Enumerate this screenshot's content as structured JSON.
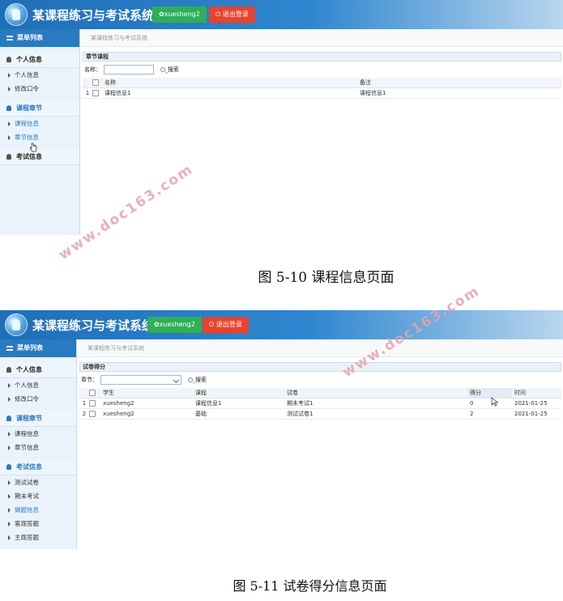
{
  "screenshot1": {
    "app_title": "某课程练习与考试系统",
    "user_button": "✿xuesheng2",
    "logout_button": "⏻ 退出登录",
    "sidebar": {
      "header": "菜单列表",
      "groups": [
        {
          "label": "个人信息",
          "items": [
            "个人信息",
            "修改口令"
          ]
        },
        {
          "label": "课程章节",
          "items": [
            "课程信息",
            "章节信息"
          ]
        },
        {
          "label": "考试信息",
          "items": []
        }
      ]
    },
    "breadcrumb": "某课程练习与考试系统",
    "panel_title": "章节课程",
    "filter_label": "名称：",
    "search_label": "搜索",
    "table": {
      "headers": [
        "名称",
        "备注"
      ],
      "rows": [
        {
          "no": "1",
          "name": "课程信息1",
          "note": "课程信息1"
        }
      ]
    }
  },
  "caption1": "图 5-10 课程信息页面",
  "screenshot2": {
    "app_title": "某课程练习与考试系统",
    "user_button": "✿xuesheng2",
    "logout_button": "⏻ 退出登录",
    "sidebar": {
      "header": "菜单列表",
      "groups": [
        {
          "label": "个人信息",
          "items": [
            "个人信息",
            "修改口令"
          ]
        },
        {
          "label": "课程章节",
          "items": [
            "课程信息",
            "章节信息"
          ]
        },
        {
          "label": "考试信息",
          "items": [
            "测试试卷",
            "期末考试",
            "做题信息",
            "客观答题",
            "主观答题"
          ]
        }
      ]
    },
    "breadcrumb": "某课程练习与考试系统",
    "panel_title": "试卷得分",
    "filter_label": "章节：",
    "search_label": "搜索",
    "table": {
      "headers": [
        "学生",
        "课程",
        "试卷",
        "得分",
        "时间"
      ],
      "rows": [
        {
          "no": "1",
          "student": "xuesheng2",
          "course": "课程信息1",
          "paper": "期末考试1",
          "score": "0",
          "time": "2021-01-25"
        },
        {
          "no": "2",
          "student": "xuesheng2",
          "course": "基础",
          "paper": "测试试卷1",
          "score": "2",
          "time": "2021-01-25"
        }
      ]
    }
  },
  "caption2": "图 5-11 试卷得分信息页面",
  "watermark": "www.doc163.com",
  "colors": {
    "header_blue": "#2a7ac2",
    "user_green": "#2eaf58",
    "logout_red": "#e8432e",
    "watermark": "#e5a3ad"
  }
}
